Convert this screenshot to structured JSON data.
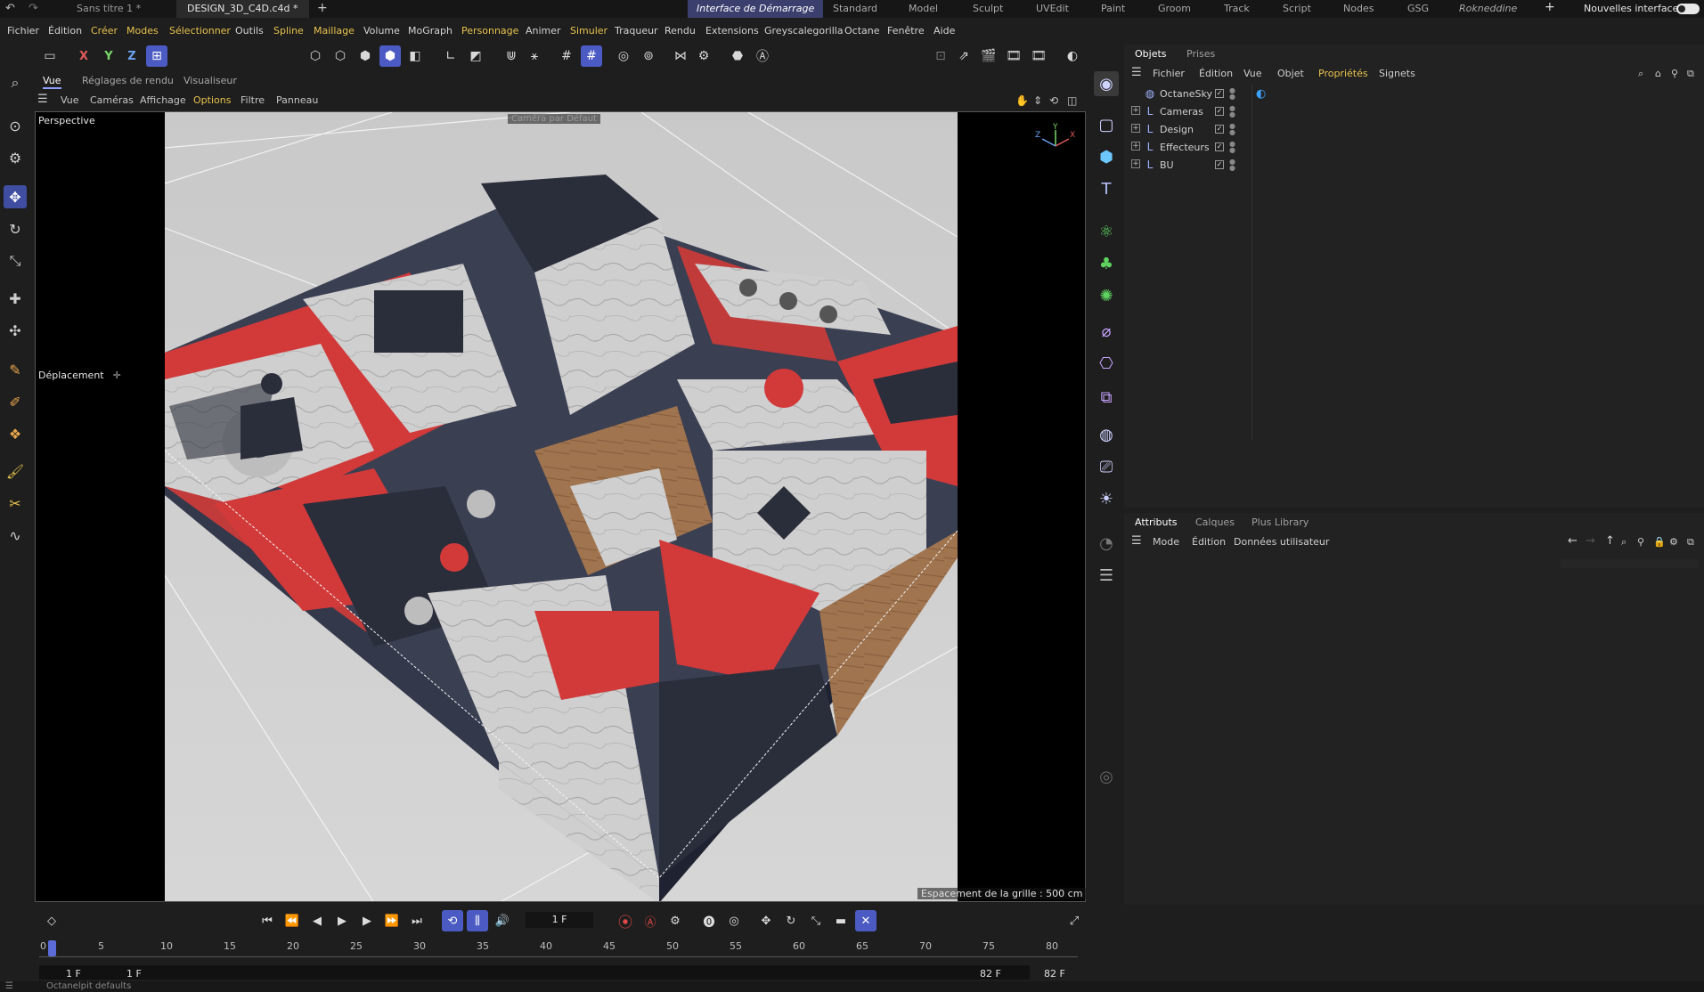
{
  "top_tabs": {
    "documents": [
      {
        "label": "Sans titre 1 *",
        "active": false
      },
      {
        "label": "DESIGN_3D_C4D.c4d *",
        "active": true
      }
    ],
    "layouts": [
      "Interface de Démarrage",
      "Standard",
      "Model",
      "Sculpt",
      "UVEdit",
      "Paint",
      "Groom",
      "Track",
      "Script",
      "Nodes",
      "GSG",
      "Rokneddine"
    ],
    "active_layout": "Interface de Démarrage",
    "new_interfaces_label": "Nouvelles interfaces"
  },
  "menu": [
    "Fichier",
    "Édition",
    "Créer",
    "Modes",
    "Sélectionner",
    "Outils",
    "Spline",
    "Maillage",
    "Volume",
    "MoGraph",
    "Personnage",
    "Animer",
    "Simuler",
    "Traqueur",
    "Rendu",
    "Extensions",
    "Greyscalegorilla",
    "Octane",
    "Fenêtre",
    "Aide"
  ],
  "toolbar": {
    "x": "X",
    "y": "Y",
    "z": "Z"
  },
  "viewport": {
    "tabs": [
      "Vue",
      "Réglages de rendu",
      "Visualiseur"
    ],
    "menu": [
      "Vue",
      "Caméras",
      "Affichage",
      "Options",
      "Filtre",
      "Panneau"
    ],
    "projection": "Perspective",
    "tool_label": "Déplacement",
    "camera_label": "Caméra par Défaut",
    "grid_spacing": "Espacement de la grille : 500 cm",
    "axis": {
      "x": "X",
      "y": "Y",
      "z": "Z"
    }
  },
  "objects_panel": {
    "tabs": [
      "Objets",
      "Prises"
    ],
    "menu": [
      "Fichier",
      "Édition",
      "Vue",
      "Objet",
      "Propriétés",
      "Signets"
    ],
    "items": [
      {
        "name": "OctaneSky"
      },
      {
        "name": "Cameras"
      },
      {
        "name": "Design"
      },
      {
        "name": "Effecteurs"
      },
      {
        "name": "BU"
      }
    ]
  },
  "attributes_panel": {
    "tabs": [
      "Attributs",
      "Calques",
      "Plus Library"
    ],
    "menu": [
      "Mode",
      "Édition",
      "Données utilisateur"
    ]
  },
  "timeline": {
    "current_frame": "1 F",
    "ruler": [
      "0",
      "5",
      "10",
      "15",
      "20",
      "25",
      "30",
      "35",
      "40",
      "45",
      "50",
      "55",
      "60",
      "65",
      "70",
      "75",
      "80"
    ],
    "range_start": "1 F",
    "range_start2": "1 F",
    "range_end": "82 F",
    "range_end2": "82 F"
  },
  "status": "Octanelpit defaults",
  "colors": {
    "accent": "#4b5bc3",
    "menu_highlight": "#e8c34d",
    "layout_active": "#3b3f6e"
  }
}
